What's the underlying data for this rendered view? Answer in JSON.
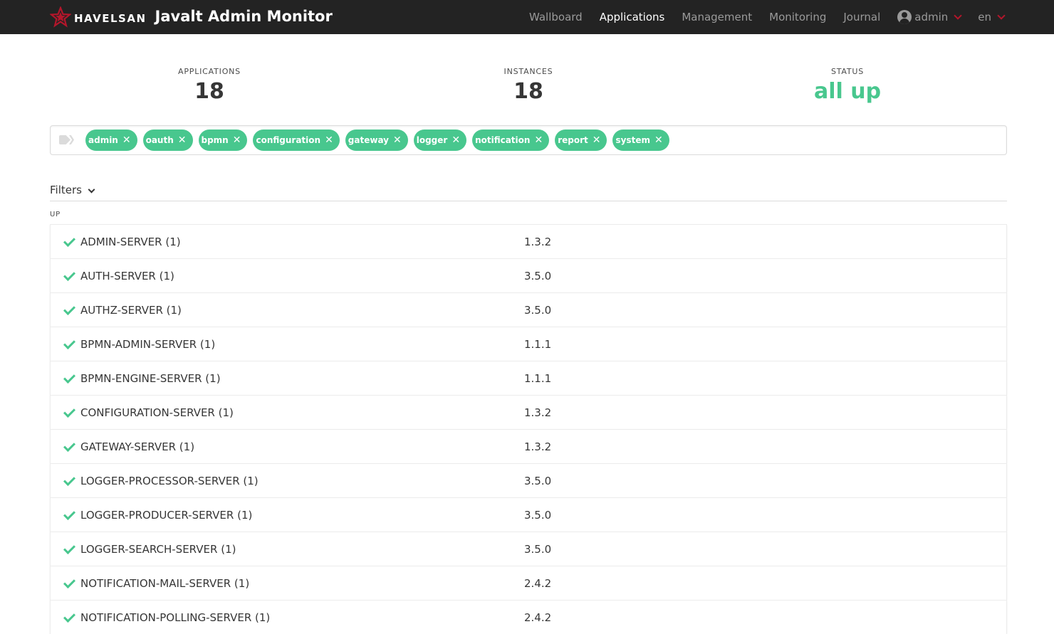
{
  "navbar": {
    "logo_text": "HAVELSAN",
    "title": "Javalt Admin Monitor",
    "items": [
      {
        "label": "Wallboard",
        "active": false
      },
      {
        "label": "Applications",
        "active": true
      },
      {
        "label": "Management",
        "active": false
      },
      {
        "label": "Monitoring",
        "active": false
      },
      {
        "label": "Journal",
        "active": false
      }
    ],
    "user": "admin",
    "language": "en"
  },
  "stats": {
    "applications_label": "APPLICATIONS",
    "applications_value": "18",
    "instances_label": "INSTANCES",
    "instances_value": "18",
    "status_label": "STATUS",
    "status_value": "all up"
  },
  "tags": [
    "admin",
    "oauth",
    "bpmn",
    "configuration",
    "gateway",
    "logger",
    "notification",
    "report",
    "system"
  ],
  "filters_label": "Filters",
  "group_label": "UP",
  "applications": [
    {
      "name": "ADMIN-SERVER (1)",
      "version": "1.3.2"
    },
    {
      "name": "AUTH-SERVER (1)",
      "version": "3.5.0"
    },
    {
      "name": "AUTHZ-SERVER (1)",
      "version": "3.5.0"
    },
    {
      "name": "BPMN-ADMIN-SERVER (1)",
      "version": "1.1.1"
    },
    {
      "name": "BPMN-ENGINE-SERVER (1)",
      "version": "1.1.1"
    },
    {
      "name": "CONFIGURATION-SERVER (1)",
      "version": "1.3.2"
    },
    {
      "name": "GATEWAY-SERVER (1)",
      "version": "1.3.2"
    },
    {
      "name": "LOGGER-PROCESSOR-SERVER (1)",
      "version": "3.5.0"
    },
    {
      "name": "LOGGER-PRODUCER-SERVER (1)",
      "version": "3.5.0"
    },
    {
      "name": "LOGGER-SEARCH-SERVER (1)",
      "version": "3.5.0"
    },
    {
      "name": "NOTIFICATION-MAIL-SERVER (1)",
      "version": "2.4.2"
    },
    {
      "name": "NOTIFICATION-POLLING-SERVER (1)",
      "version": "2.4.2"
    }
  ],
  "colors": {
    "navbar_bg": "#232323",
    "accent_green": "#48c78e",
    "brand_red": "#b3162b"
  }
}
